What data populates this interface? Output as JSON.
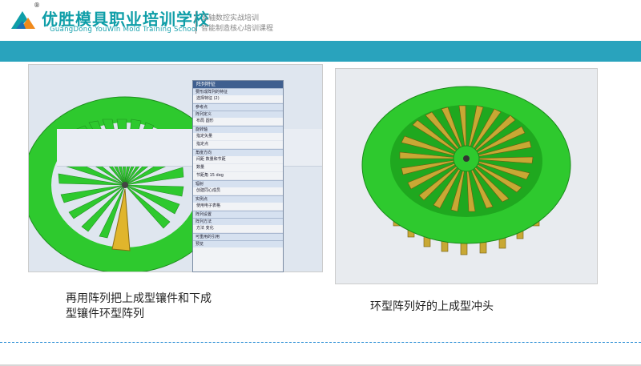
{
  "header": {
    "reg_mark": "®",
    "school_name": "优胜模具职业培训学校",
    "school_name_en": "GuangDong YouWin Mold Training School",
    "slogan_line1": "五轴数控实战培训",
    "slogan_line2": "智能制造核心培训课程"
  },
  "colors": {
    "accent_band": "#29a3bd",
    "model_green": "#2ec92e",
    "blade_gold": "#c8a834",
    "dashed_line": "#2d8fd5"
  },
  "left_panel": {
    "caption_line1": "再用阵列把上成型镶件和下成",
    "caption_line2": "型镶件环型阵列",
    "dialog": {
      "title": "阵列特征",
      "sections": [
        "要形成阵列的特征",
        "参考点",
        "阵列定义",
        "旋转轴",
        "角度方向",
        "辐射",
        "实例点",
        "阵列设置",
        "阵列方法",
        "可重用的引用",
        "预览"
      ],
      "rows": [
        "选择特征 (2)",
        "布局  圆形",
        "指定矢量",
        "指定点",
        "间距  数量和节距",
        "数量",
        "节距角  15  deg",
        "创建同心成员",
        "使用电子表格",
        "方法  变化"
      ]
    }
  },
  "right_panel": {
    "caption": "环型阵列好的上成型冲头"
  }
}
